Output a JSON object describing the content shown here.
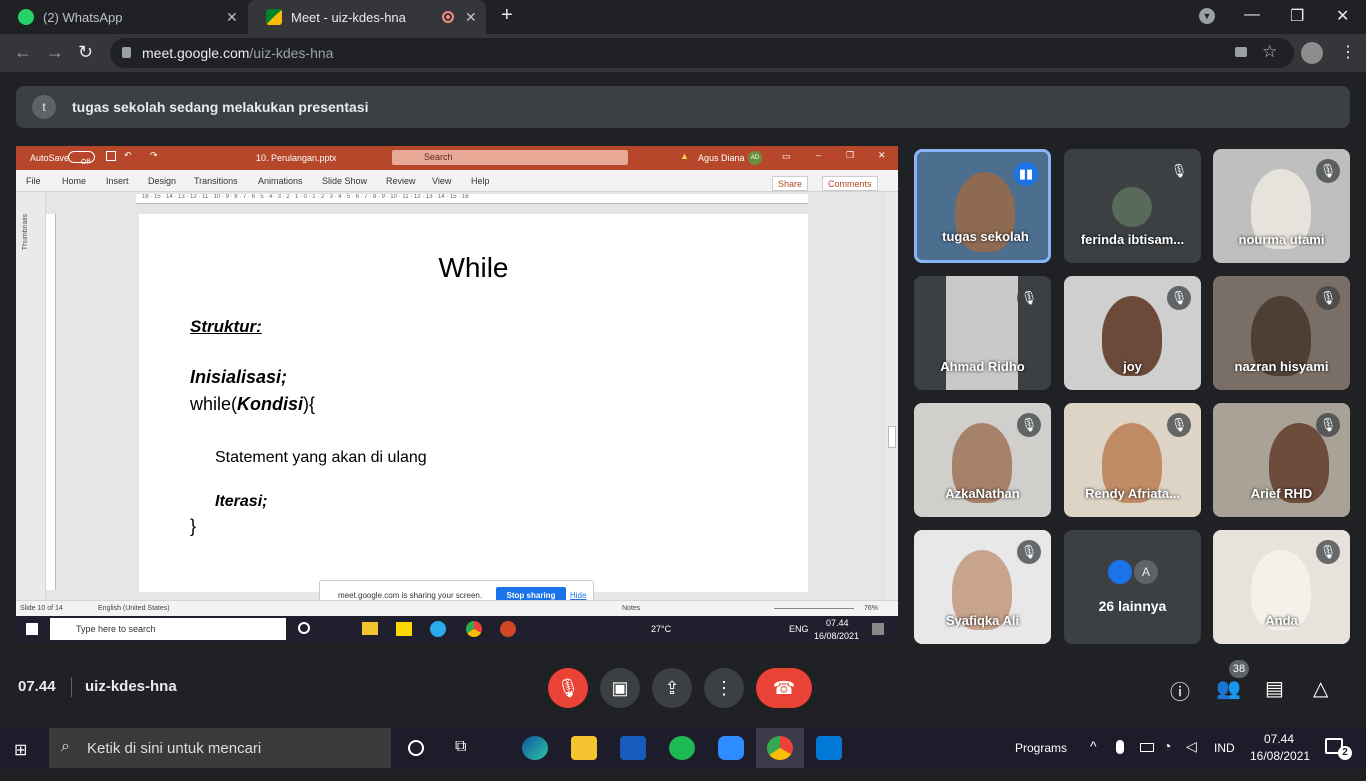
{
  "browser": {
    "tabs": [
      {
        "label": "(2) WhatsApp",
        "icon": "whatsapp-icon"
      },
      {
        "label": "Meet - uiz-kdes-hna",
        "icon": "meet-icon",
        "recording": true
      }
    ],
    "url_host": "meet.google.com",
    "url_path": "/uiz-kdes-hna"
  },
  "meet": {
    "presenter_avatar": "t",
    "presenting_text": "tugas sekolah sedang melakukan presentasi",
    "meeting_time": "07.44",
    "meeting_code": "uiz-kdes-hna",
    "participant_count": "38",
    "tiles": [
      {
        "name": "tugas sekolah",
        "mic": "speaking",
        "active": true
      },
      {
        "name": "ferinda ibtisam...",
        "mic": "muted"
      },
      {
        "name": "nourma utami",
        "mic": "muted"
      },
      {
        "name": "Ahmad Ridho",
        "mic": "muted"
      },
      {
        "name": "joy",
        "mic": "muted"
      },
      {
        "name": "nazran hisyami",
        "mic": "muted"
      },
      {
        "name": "AzkaNathan",
        "mic": "muted"
      },
      {
        "name": "Rendy Afriata...",
        "mic": "muted"
      },
      {
        "name": "Arief RHD",
        "mic": "muted"
      },
      {
        "name": "Syafiqka Ali",
        "mic": "muted"
      },
      {
        "name": "26 lainnya",
        "avatar_letter": "A"
      },
      {
        "name": "Anda",
        "mic": "muted"
      }
    ]
  },
  "ppt": {
    "autosave": "AutoSave",
    "autosave_state": "Off",
    "filename": "10. Perulangan.pptx",
    "search": "Search",
    "user": "Agus Diana",
    "user_initials": "AD",
    "ribbon_tabs": [
      "File",
      "Home",
      "Insert",
      "Design",
      "Transitions",
      "Animations",
      "Slide Show",
      "Review",
      "View",
      "Help"
    ],
    "share": "Share",
    "comments": "Comments",
    "thumbnails": "Thumbnails",
    "ruler": "16 · 15 · 14 · 13 · 12 · 11 · 10 · 9 · 8 · 7 · 6 · 5 · 4 · 3 · 2 · 1 · 0 · 1 · 2 · 3 · 4 · 5 · 6 · 7 · 8 · 9 · 10 · 11 · 12 · 13 · 14 · 15 · 16",
    "slide_title": "While",
    "slide_lines": {
      "struktur": "Struktur:",
      "init": "Inisialisasi;",
      "while_kw": "while(",
      "kondisi": "Kondisi",
      "while_end": "){",
      "statement": "Statement yang akan di ulang",
      "iterasi": "Iterasi;",
      "close": "}"
    },
    "status_slide": "Slide 10 of 14",
    "status_lang": "English (United States)",
    "status_notes": "Notes",
    "status_zoom": "76%",
    "share_notice": "meet.google.com is sharing your screen.",
    "stop_sharing": "Stop sharing",
    "hide": "Hide",
    "inner_search": "Type here to search",
    "inner_temp": "27°C",
    "inner_lang": "ENG",
    "inner_time": "07.44",
    "inner_date": "16/08/2021"
  },
  "taskbar": {
    "search_placeholder": "Ketik di sini untuk mencari",
    "programs": "Programs",
    "lang": "IND",
    "time": "07.44",
    "date": "16/08/2021",
    "notifications": "2"
  },
  "colors": {
    "meet_bg": "#202124",
    "tile_bg": "#3c4043",
    "end_call": "#ea4335",
    "ppt_brand": "#b7472a",
    "active_speaker": "#8ab4f8"
  }
}
